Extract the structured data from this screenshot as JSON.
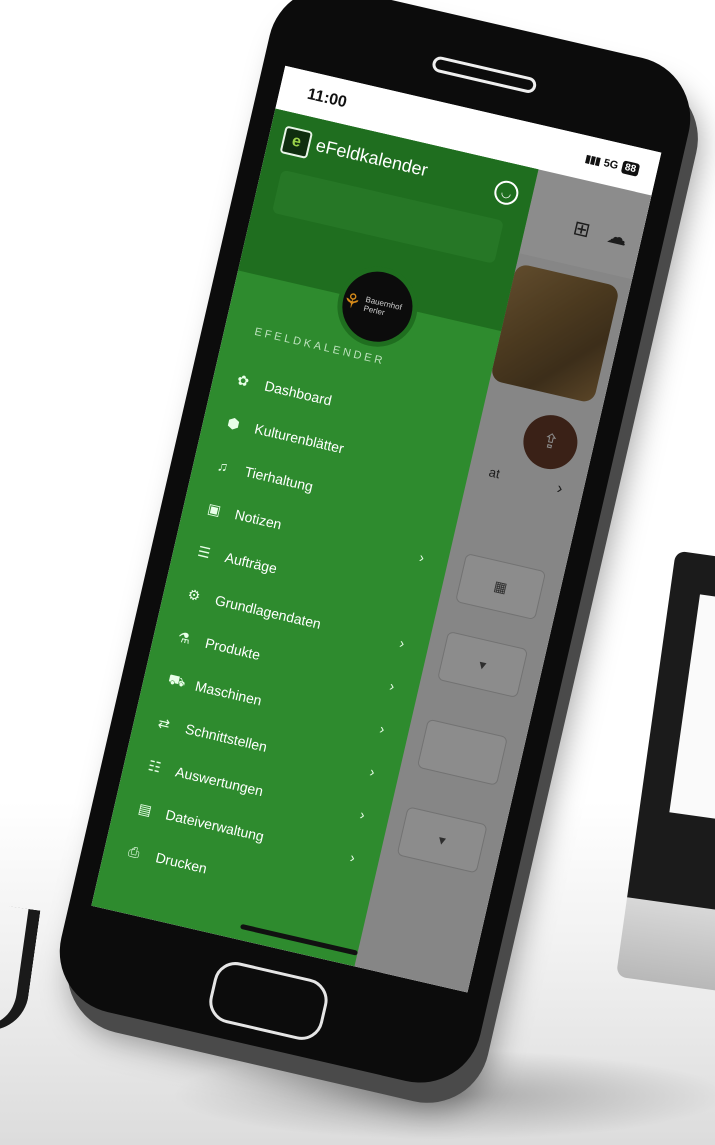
{
  "status": {
    "time": "11:00",
    "network": "5G",
    "battery": "88"
  },
  "drawer": {
    "app_name": "eFeldkalender",
    "logo_letter": "e",
    "farm_name": "Bauernhof Perler",
    "section_label": "EFELDKALENDER",
    "items": [
      {
        "label": "Dashboard",
        "icon": "dashboard-icon",
        "glyph": "✿",
        "has_chevron": false
      },
      {
        "label": "Kulturenblätter",
        "icon": "location-icon",
        "glyph": "⬢",
        "has_chevron": false
      },
      {
        "label": "Tierhaltung",
        "icon": "bell-icon",
        "glyph": "♫",
        "has_chevron": false
      },
      {
        "label": "Notizen",
        "icon": "clipboard-icon",
        "glyph": "▣",
        "has_chevron": true
      },
      {
        "label": "Aufträge",
        "icon": "list-icon",
        "glyph": "☰",
        "has_chevron": false
      },
      {
        "label": "Grundlagendaten",
        "icon": "gears-icon",
        "glyph": "⚙",
        "has_chevron": true
      },
      {
        "label": "Produkte",
        "icon": "flask-icon",
        "glyph": "⚗",
        "has_chevron": true
      },
      {
        "label": "Maschinen",
        "icon": "tractor-icon",
        "glyph": "⛟",
        "has_chevron": true
      },
      {
        "label": "Schnittstellen",
        "icon": "swap-icon",
        "glyph": "⇄",
        "has_chevron": true
      },
      {
        "label": "Auswertungen",
        "icon": "chart-icon",
        "glyph": "☷",
        "has_chevron": true
      },
      {
        "label": "Dateiverwaltung",
        "icon": "archive-icon",
        "glyph": "▤",
        "has_chevron": true
      },
      {
        "label": "Drucken",
        "icon": "print-icon",
        "glyph": "⎙",
        "has_chevron": false
      }
    ]
  },
  "app": {
    "partial_text": "at"
  },
  "colors": {
    "drawer_green": "#2e8b2e",
    "drawer_head": "#1f6e1f",
    "fab_brown": "#6a3d2b"
  }
}
